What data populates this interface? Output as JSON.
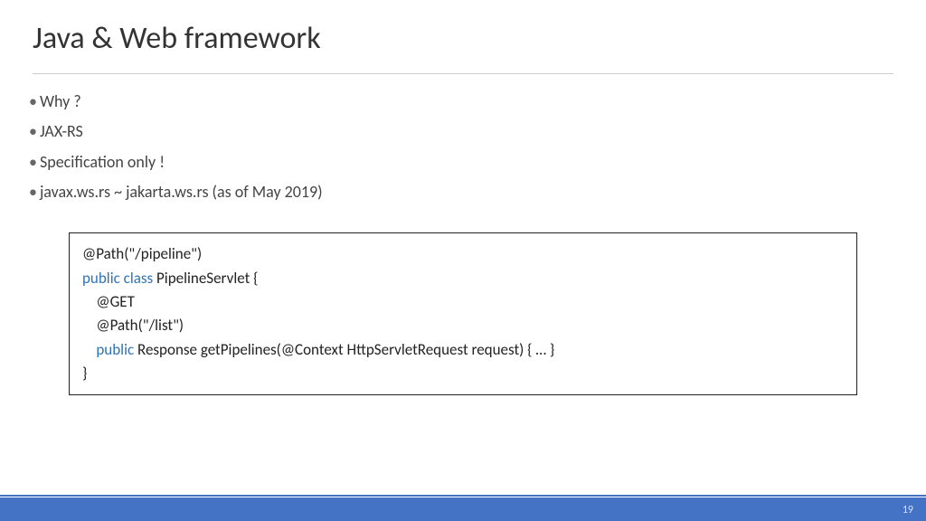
{
  "title": "Java & Web framework",
  "bullets": [
    "Why ?",
    "JAX-RS",
    "Specification only !",
    "javax.ws.rs ~ jakarta.ws.rs (as of May 2019)"
  ],
  "code": {
    "line1": "@Path(\"/pipeline\")",
    "kw_public_class": "public class",
    "line2_rest": " PipelineServlet {",
    "blank1": "",
    "line3": "    @GET",
    "line4": "    @Path(\"/list\")",
    "indent5": "    ",
    "kw_public": "public",
    "line5_rest": " Response getPipelines(@Context HttpServletRequest request) { … }",
    "blank2": "",
    "line6": "}"
  },
  "page_number": "19"
}
